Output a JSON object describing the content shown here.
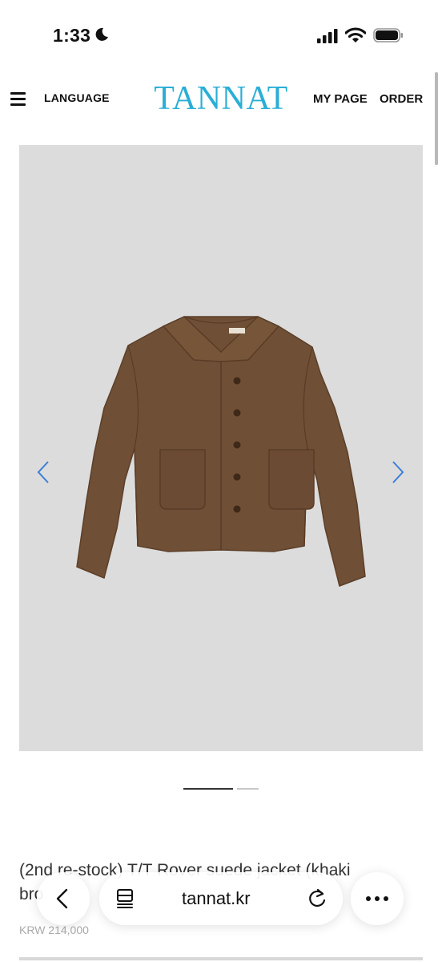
{
  "status_bar": {
    "time": "1:33"
  },
  "header": {
    "menu_icon": "hamburger-icon",
    "language_label": "LANGUAGE",
    "logo_text": "TANNAT",
    "my_page_label": "MY PAGE",
    "order_label": "ORDER"
  },
  "colors": {
    "brand": "#2aaed6",
    "image_bg": "#dcdcdc",
    "nav_arrow": "#3a7fd8"
  },
  "gallery": {
    "slides_total": 2,
    "active_slide": 1
  },
  "product": {
    "title_line1": "(2nd re-stock) T/T Rover suede jacket (khaki",
    "title_line2": "bro",
    "price": "KRW 214,000"
  },
  "browser": {
    "url": "tannat.kr"
  }
}
